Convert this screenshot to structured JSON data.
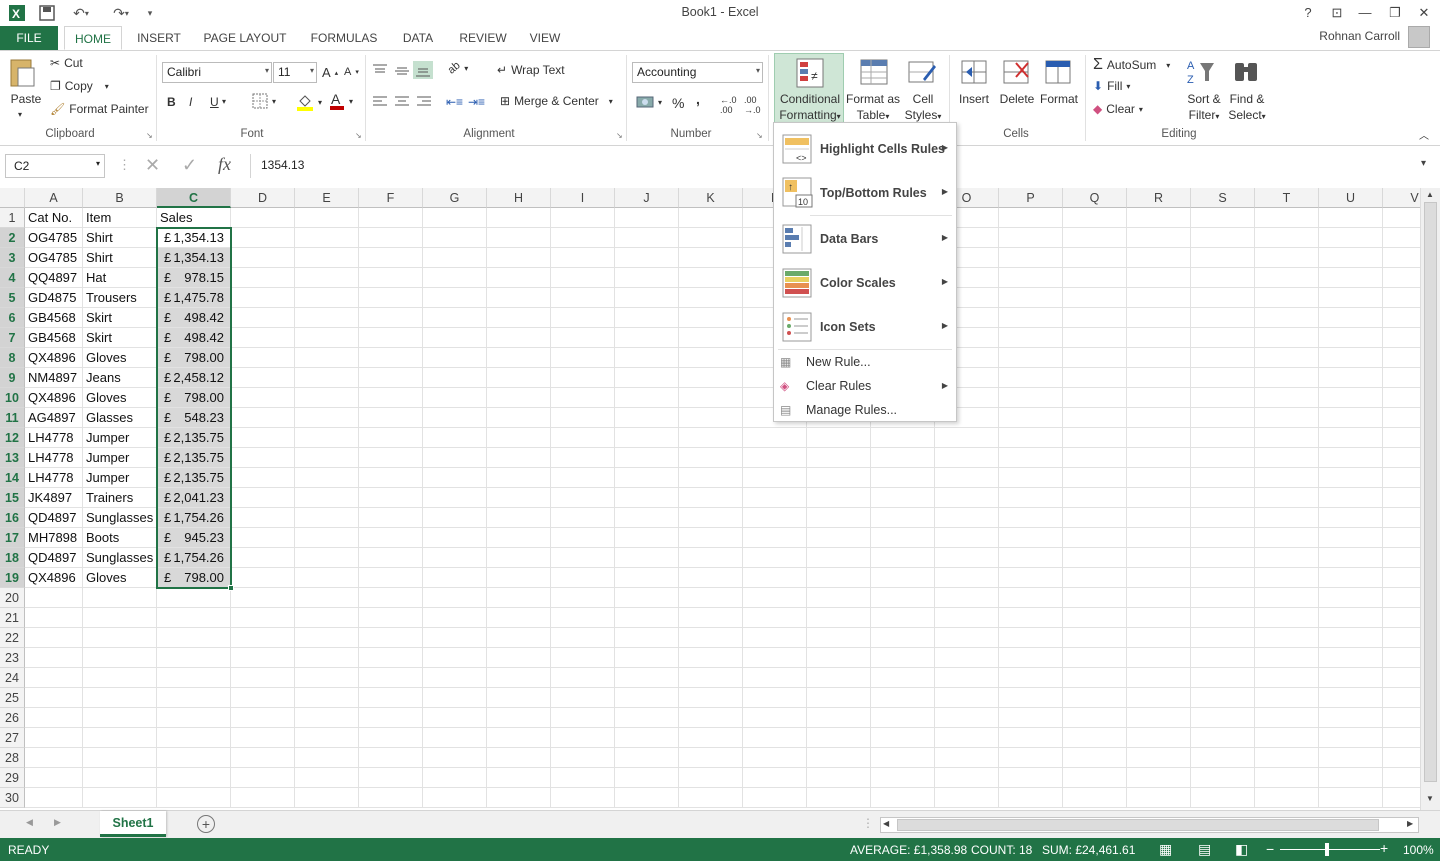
{
  "window": {
    "title": "Book1 - Excel",
    "user": "Rohnan Carroll",
    "help": "?"
  },
  "tabs": [
    "FILE",
    "HOME",
    "INSERT",
    "PAGE LAYOUT",
    "FORMULAS",
    "DATA",
    "REVIEW",
    "VIEW"
  ],
  "ribbon": {
    "clipboard": {
      "paste": "Paste",
      "cut": "Cut",
      "copy": "Copy",
      "format_painter": "Format Painter",
      "label": "Clipboard"
    },
    "font": {
      "name": "Calibri",
      "size": "11",
      "bold": "B",
      "italic": "I",
      "underline": "U",
      "label": "Font"
    },
    "alignment": {
      "wrap": "Wrap Text",
      "merge": "Merge & Center",
      "label": "Alignment"
    },
    "number": {
      "format": "Accounting",
      "percent": "%",
      "comma": ",",
      "label": "Number"
    },
    "styles": {
      "cf_line1": "Conditional",
      "cf_line2": "Formatting",
      "fat_line1": "Format as",
      "fat_line2": "Table",
      "cs_line1": "Cell",
      "cs_line2": "Styles"
    },
    "cells": {
      "insert": "Insert",
      "delete": "Delete",
      "format": "Format",
      "label": "Cells"
    },
    "editing": {
      "autosum": "AutoSum",
      "fill": "Fill",
      "clear": "Clear",
      "sort_line1": "Sort &",
      "sort_line2": "Filter",
      "find_line1": "Find &",
      "find_line2": "Select",
      "label": "Editing"
    }
  },
  "formula_bar": {
    "name_box": "C2",
    "fx": "fx",
    "value": "1354.13"
  },
  "columns": [
    "A",
    "B",
    "C",
    "D",
    "E",
    "F",
    "G",
    "H",
    "I",
    "J",
    "K",
    "L",
    "M",
    "N",
    "O",
    "P",
    "Q",
    "R",
    "S",
    "T",
    "U",
    "V"
  ],
  "header_row": {
    "a": "Cat No.",
    "b": "Item",
    "c": "Sales"
  },
  "rows": [
    {
      "a": "OG4785",
      "b": "Shirt",
      "cur": "£",
      "amt": "1,354.13"
    },
    {
      "a": "OG4785",
      "b": "Shirt",
      "cur": "£",
      "amt": "1,354.13"
    },
    {
      "a": "QQ4897",
      "b": "Hat",
      "cur": "£",
      "amt": "978.15"
    },
    {
      "a": "GD4875",
      "b": "Trousers",
      "cur": "£",
      "amt": "1,475.78"
    },
    {
      "a": "GB4568",
      "b": "Skirt",
      "cur": "£",
      "amt": "498.42"
    },
    {
      "a": "GB4568",
      "b": "Skirt",
      "cur": "£",
      "amt": "498.42"
    },
    {
      "a": "QX4896",
      "b": "Gloves",
      "cur": "£",
      "amt": "798.00"
    },
    {
      "a": "NM4897",
      "b": "Jeans",
      "cur": "£",
      "amt": "2,458.12"
    },
    {
      "a": "QX4896",
      "b": "Gloves",
      "cur": "£",
      "amt": "798.00"
    },
    {
      "a": "AG4897",
      "b": "Glasses",
      "cur": "£",
      "amt": "548.23"
    },
    {
      "a": "LH4778",
      "b": "Jumper",
      "cur": "£",
      "amt": "2,135.75"
    },
    {
      "a": "LH4778",
      "b": "Jumper",
      "cur": "£",
      "amt": "2,135.75"
    },
    {
      "a": "LH4778",
      "b": "Jumper",
      "cur": "£",
      "amt": "2,135.75"
    },
    {
      "a": "JK4897",
      "b": "Trainers",
      "cur": "£",
      "amt": "2,041.23"
    },
    {
      "a": "QD4897",
      "b": "Sunglasses",
      "cur": "£",
      "amt": "1,754.26"
    },
    {
      "a": "MH7898",
      "b": "Boots",
      "cur": "£",
      "amt": "945.23"
    },
    {
      "a": "QD4897",
      "b": "Sunglasses",
      "cur": "£",
      "amt": "1,754.26"
    },
    {
      "a": "QX4896",
      "b": "Gloves",
      "cur": "£",
      "amt": "798.00"
    }
  ],
  "row_count": 30,
  "cf_menu": {
    "highlight": "Highlight Cells Rules",
    "topbottom": "Top/Bottom Rules",
    "databars": "Data Bars",
    "colorscales": "Color Scales",
    "iconsets": "Icon Sets",
    "newrule": "New Rule...",
    "clearrules": "Clear Rules",
    "managerules": "Manage Rules..."
  },
  "sheet_tab": "Sheet1",
  "status": {
    "ready": "READY",
    "average": "AVERAGE: £1,358.98",
    "count": "COUNT: 18",
    "sum": "SUM: £24,461.61",
    "zoom": "100%"
  },
  "colors": {
    "accent": "#217346"
  }
}
